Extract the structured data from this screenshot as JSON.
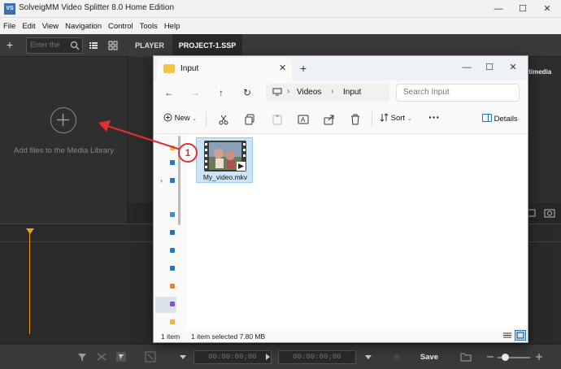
{
  "app": {
    "title": "SolveigMM Video Splitter 8.0 Home Edition",
    "icon_text": "VS",
    "window_controls": [
      "minimize",
      "maximize",
      "close"
    ]
  },
  "menu": [
    "File",
    "Edit",
    "View",
    "Navigation",
    "Control",
    "Tools",
    "Help"
  ],
  "toolbar": {
    "search_placeholder": "Enter the",
    "tabs": [
      "PLAYER",
      "PROJECT-1.SSP"
    ]
  },
  "media_library": {
    "empty_text": "Add files to the Media Library"
  },
  "right_panel": {
    "label": "ltimedia"
  },
  "bottombar": {
    "timecode_start": "00:00:00;00",
    "timecode_end": "00:00:00;00",
    "save_label": "Save"
  },
  "explorer": {
    "tab_label": "Input",
    "breadcrumbs": [
      "Videos",
      "Input"
    ],
    "search_placeholder": "Search Input",
    "commands": {
      "new_label": "New",
      "sort_label": "Sort",
      "details_label": "Details"
    },
    "file": {
      "name": "My_video.mkv"
    },
    "status": {
      "count": "1 item",
      "selected": "1 item selected  7.80 MB"
    }
  },
  "annotation": {
    "number": "1",
    "color": "#e03030"
  },
  "colors": {
    "app_bg": "#2d2d2d",
    "accent_playhead": "#f0a020",
    "selection": "#cce4f7"
  }
}
